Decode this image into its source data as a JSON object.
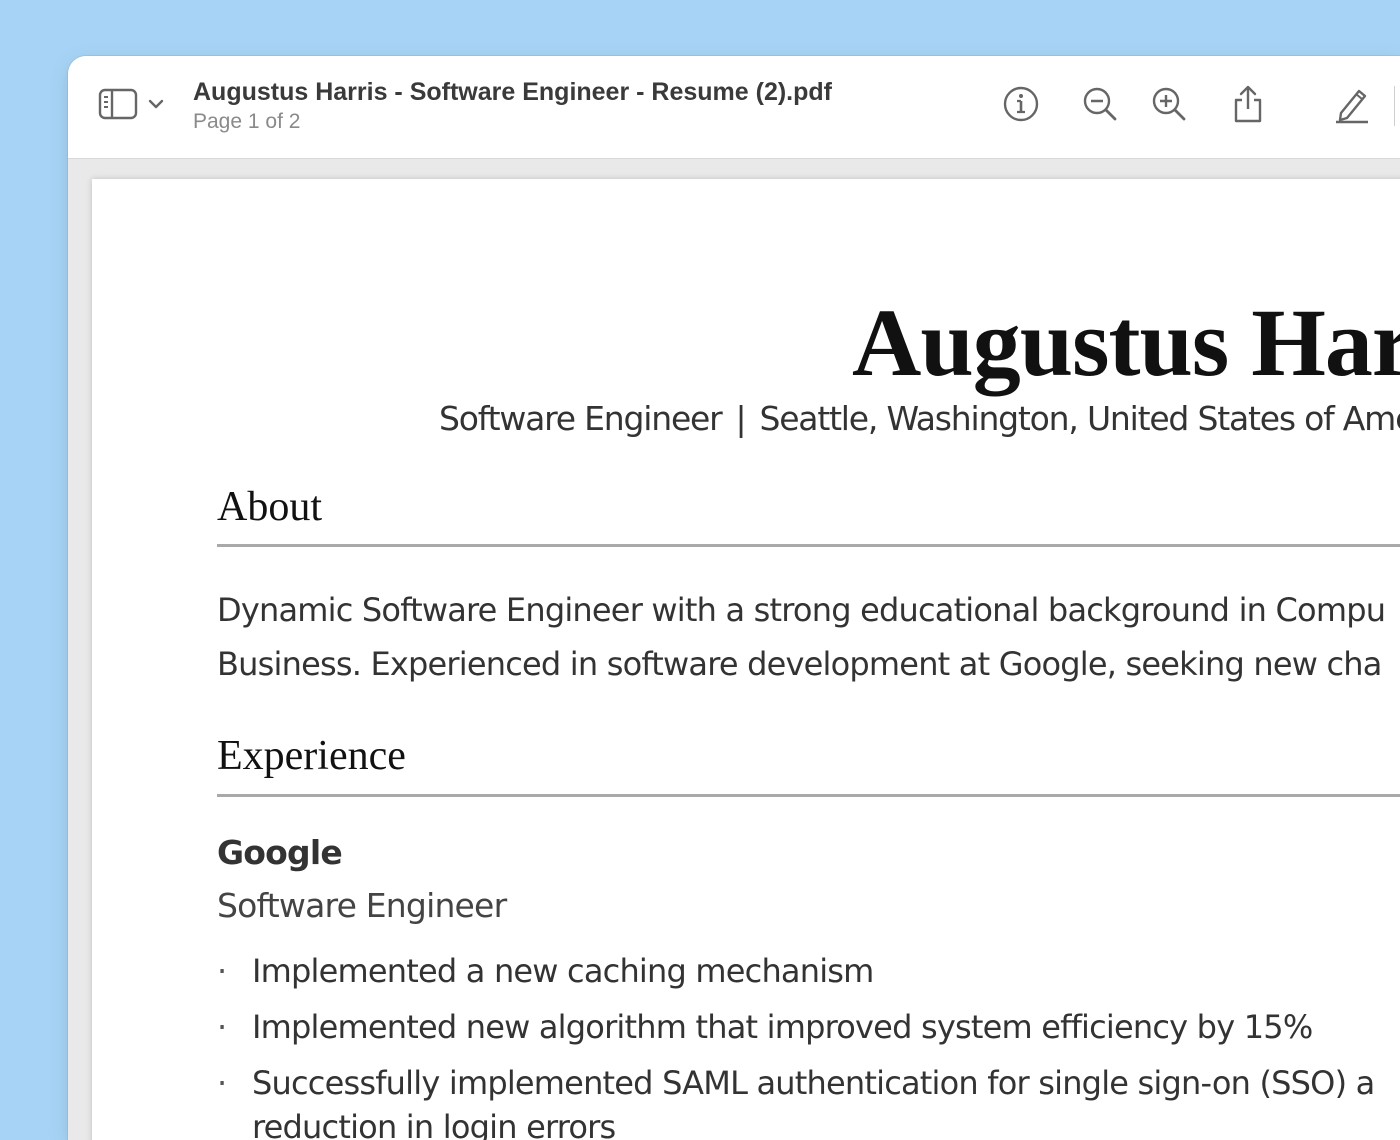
{
  "window": {
    "title": "Augustus Harris - Software Engineer - Resume (2).pdf",
    "subtitle": "Page 1 of 2"
  },
  "toolbar": {
    "icons": [
      "sidebar-icon",
      "chevron-down-icon",
      "info-icon",
      "zoom-out-icon",
      "zoom-in-icon",
      "share-icon",
      "markup-pencil-icon"
    ]
  },
  "resume": {
    "name": "Augustus Harr",
    "tagline": {
      "role": "Software Engineer",
      "separator": "|",
      "location": "Seattle, Washington, United States of Amer"
    },
    "about": {
      "heading": "About",
      "lines": [
        "Dynamic Software Engineer with a strong educational background in Compu",
        "Business. Experienced in software development at Google, seeking new cha"
      ]
    },
    "experience": {
      "heading": "Experience",
      "company": "Google",
      "role": "Software Engineer",
      "bullets": [
        {
          "lines": [
            "Implemented a new caching mechanism"
          ]
        },
        {
          "lines": [
            "Implemented new algorithm that improved system efficiency by 15%"
          ]
        },
        {
          "lines": [
            "Successfully implemented SAML authentication for single sign-on (SSO) a",
            "reduction in login errors"
          ]
        }
      ],
      "bullet_char": "·"
    }
  }
}
